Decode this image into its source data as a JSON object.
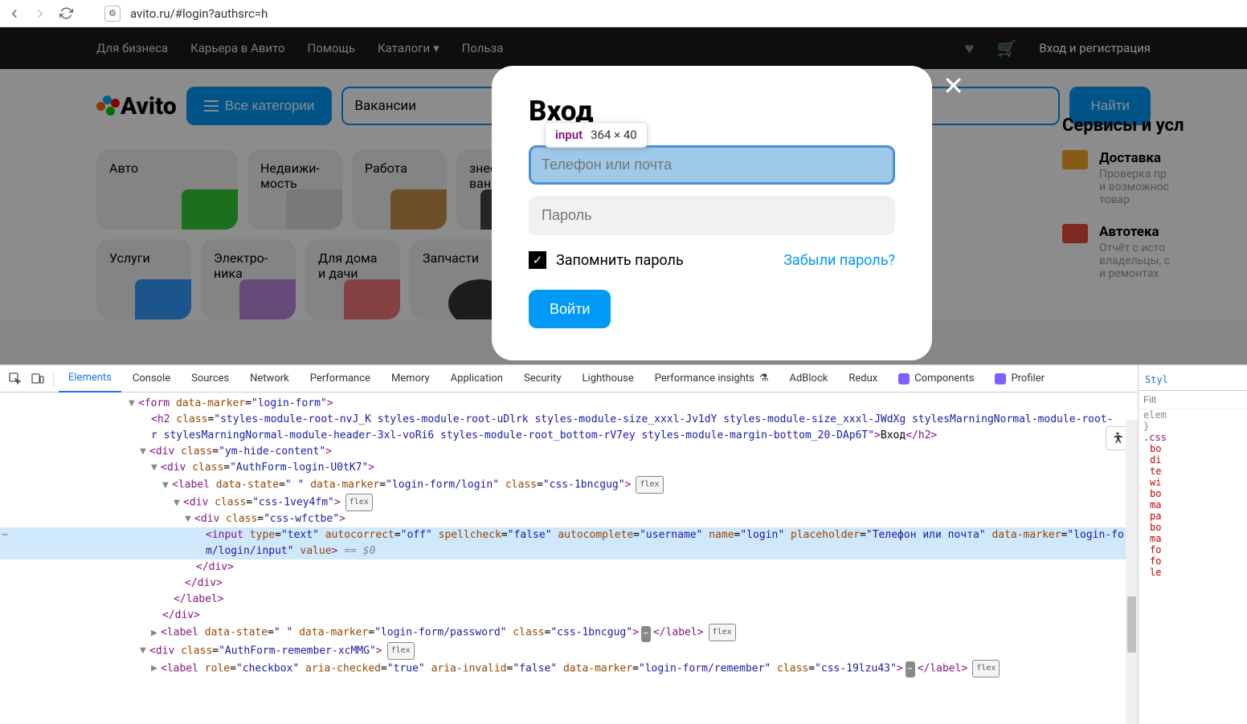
{
  "browser": {
    "url": "avito.ru/#login?authsrc=h"
  },
  "topnav": {
    "business": "Для бизнеса",
    "career": "Карьера в Авито",
    "help": "Помощь",
    "catalogs": "Каталоги",
    "benefit": "Польза",
    "login": "Вход и регистрация"
  },
  "search": {
    "logo": "Avito",
    "all_categories": "Все категории",
    "placeholder_value": "Вакансии",
    "find": "Найти"
  },
  "tiles": {
    "auto": "Авто",
    "realty": "Недвижи-\nмость",
    "work": "Работа",
    "services": "Услуги",
    "electronics": "Электро-\nника",
    "home": "Для дома\nи дачи",
    "parts": "Запчасти",
    "biz": "знес\nвание"
  },
  "services_col": {
    "heading": "Сервисы и усл",
    "delivery_title": "Доставка",
    "delivery_desc": "Проверка пр\nи возможнос\nтовар",
    "autoteka_title": "Автотека",
    "autoteka_desc": "Отчёт с исто\nвладельцы, с\nи ремонтах"
  },
  "modal": {
    "title": "Вход",
    "login_placeholder": "Телефон или почта",
    "password_placeholder": "Пароль",
    "remember": "Запомнить пароль",
    "forgot": "Забыли пароль?",
    "submit": "Войти"
  },
  "inspect_tip": {
    "tag": "input",
    "dims": "364 × 40"
  },
  "devtools": {
    "tabs": {
      "elements": "Elements",
      "console": "Console",
      "sources": "Sources",
      "network": "Network",
      "performance": "Performance",
      "memory": "Memory",
      "application": "Application",
      "security": "Security",
      "lighthouse": "Lighthouse",
      "perf_insights": "Performance insights",
      "adblock": "AdBlock",
      "redux": "Redux",
      "components": "Components",
      "profiler": "Profiler"
    },
    "styles_tab": "Styl",
    "filter_placeholder": "Filt",
    "elem_style": "elem",
    "brace": "}",
    "css_selector": ".css",
    "css_props": [
      "bo",
      "di",
      "te",
      "wi",
      "bo",
      "ma",
      "pa",
      "bo",
      "ma",
      "fo",
      "fo",
      "le"
    ],
    "code": {
      "l1_a": "<form",
      "l1_b": "data-marker",
      "l1_c": "\"login-form\"",
      "l1_d": ">",
      "l2_a": "<h2",
      "l2_b": "class",
      "l2_c": "\"styles-module-root-nvJ_K styles-module-root-uDlrk styles-module-size_xxxl-Jv1dY styles-module-size_xxxl-JWdXg stylesMarningNormal-module-root-",
      "l2_d": "r stylesMarningNormal-module-header-3xl-voRi6 styles-module-root_bottom-rV7ey styles-module-margin-bottom_20-DAp6T\"",
      "l2_e": ">",
      "l2_txt": "Вход",
      "l2_close": "</h2>",
      "l3_a": "<div",
      "l3_b": "class",
      "l3_c": "\"ym-hide-content\"",
      "l3_d": ">",
      "l4_c": "\"AuthForm-login-U0tK7\"",
      "l5_a": "<label",
      "l5_b": "data-state",
      "l5_c": "\" \"",
      "l5_d": "data-marker",
      "l5_e": "\"login-form/login\"",
      "l5_f": "class",
      "l5_g": "\"css-1bncgug\"",
      "l5_h": ">",
      "l6_c": "\"css-1vey4fm\"",
      "l7_c": "\"css-wfctbe\"",
      "l8_a": "<input",
      "l8_b": "type",
      "l8_c": "\"text\"",
      "l8_d": "autocorrect",
      "l8_e": "\"off\"",
      "l8_f": "spellcheck",
      "l8_g": "\"false\"",
      "l8_h": "autocomplete",
      "l8_i": "\"username\"",
      "l8_j": "name",
      "l8_k": "\"login\"",
      "l8_l": "placeholder",
      "l8_m": "\"Телефон или почта\"",
      "l8_n": "data-marker",
      "l8_o": "\"login-for",
      "l8_p": "m/login/input\"",
      "l8_q": "value",
      "l8_r": ">",
      "l8_s": " == $0",
      "l9": "</div>",
      "l10": "</div>",
      "l11": "</label>",
      "l12": "</div>",
      "l13_e": "\"login-form/password\"",
      "l13_close": "</label>",
      "l14_c": "\"AuthForm-remember-xcMMG\"",
      "l15_b": "role",
      "l15_c": "\"checkbox\"",
      "l15_d": "aria-checked",
      "l15_e": "\"true\"",
      "l15_f": "aria-invalid",
      "l15_g": "\"false\"",
      "l15_h": "data-marker",
      "l15_i": "\"login-form/remember\"",
      "l15_j": "class",
      "l15_k": "\"css-19lzu43\"",
      "l15_close": "</label>"
    }
  }
}
